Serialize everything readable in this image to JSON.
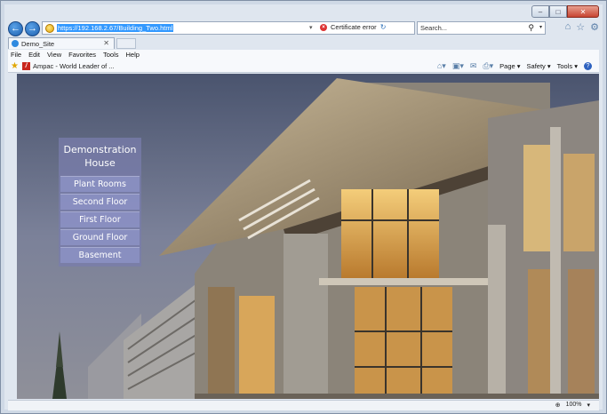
{
  "browser": {
    "address_url": "https://192.168.2.67/Building_Two.html",
    "cert_text": "Certificate error",
    "search_placeholder": "Search...",
    "tab_title": "Demo_Site",
    "menu": [
      "File",
      "Edit",
      "View",
      "Favorites",
      "Tools",
      "Help"
    ],
    "favorite_link": "Ampac - World Leader of ...",
    "commands": {
      "page": "Page ▾",
      "safety": "Safety ▾",
      "tools": "Tools ▾"
    },
    "zoom": "100%"
  },
  "site": {
    "panel_title": "Demonstration House",
    "nav_items": [
      "Plant Rooms",
      "Second Floor",
      "First Floor",
      "Ground Floor",
      "Basement"
    ]
  },
  "colors": {
    "panel": "#787caa",
    "nav_item": "#8c92c4",
    "sky": "#4d5872"
  }
}
